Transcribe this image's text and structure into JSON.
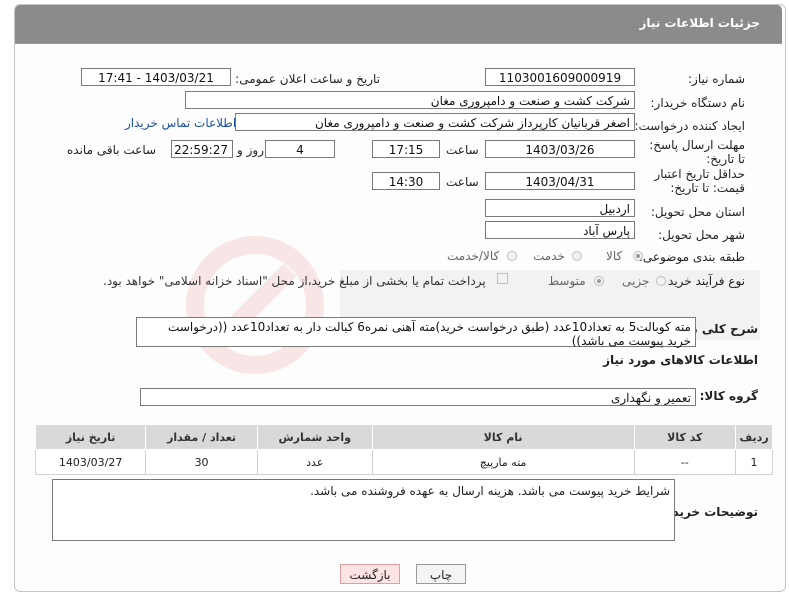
{
  "header": {
    "title": "جزئیات اطلاعات نیاز"
  },
  "form": {
    "need_number_label": "شماره نیاز:",
    "need_number": "1103001609000919",
    "announce_label": "تاریخ و ساعت اعلان عمومی:",
    "announce_value": "1403/03/21 - 17:41",
    "buyer_org_label": "نام دستگاه خریدار:",
    "buyer_org": "شرکت کشت و صنعت و دامپروری مغان",
    "requester_label": "ایجاد کننده درخواست:",
    "requester": "اصغر قربانیان کارپرداز شرکت کشت و صنعت و دامپروری مغان",
    "contact_link": "اطلاعات تماس خریدار",
    "reply_deadline_label": "مهلت ارسال پاسخ: تا تاریخ:",
    "reply_date": "1403/03/26",
    "time_label": "ساعت",
    "reply_time": "17:15",
    "days_value": "4",
    "days_label": "روز و",
    "remaining_time": "22:59:27",
    "remaining_label": "ساعت باقی مانده",
    "price_valid_label": "حداقل تاریخ اعتبار قیمت: تا تاریخ:",
    "price_valid_date": "1403/04/31",
    "price_valid_time": "14:30",
    "province_label": "استان محل تحویل:",
    "province": "اردبیل",
    "city_label": "شهر محل تحویل:",
    "city": "پارس آباد",
    "category_label": "طبقه بندی موضوعی:",
    "category_options": [
      "کالا",
      "خدمت",
      "کالا/خدمت"
    ],
    "process_label": "نوع فرآیند خرید :",
    "process_options": [
      "جزیی",
      "متوسط"
    ],
    "payment_note": "پرداخت تمام یا بخشی از مبلغ خرید،از محل \"اسناد خزانه اسلامی\" خواهد بود.",
    "description_label": "شرح کلی نیاز:",
    "description": "مته کوبالت5 به تعداد10عدد (طبق درخواست خرید)مته آهنی نمره6 کبالت دار به تعداد10عدد ((درخواست خرید پیوست می باشد))",
    "goods_info_title": "اطلاعات کالاهای مورد نیاز",
    "goods_group_label": "گروه کالا:",
    "goods_group": "تعمیر و نگهداری"
  },
  "table": {
    "headers": [
      "ردیف",
      "کد کالا",
      "نام کالا",
      "واحد شمارش",
      "تعداد / مقدار",
      "تاریخ نیاز"
    ],
    "rows": [
      [
        "1",
        "--",
        "مته مارپیچ",
        "عدد",
        "30",
        "1403/03/27"
      ]
    ]
  },
  "buyer_notes_label": "توضیحات خریدار:",
  "buyer_notes": "شرایط خرید پیوست می باشد. هزینه ارسال به عهده فروشنده می باشد.",
  "buttons": {
    "print": "چاپ",
    "back": "بازگشت"
  }
}
